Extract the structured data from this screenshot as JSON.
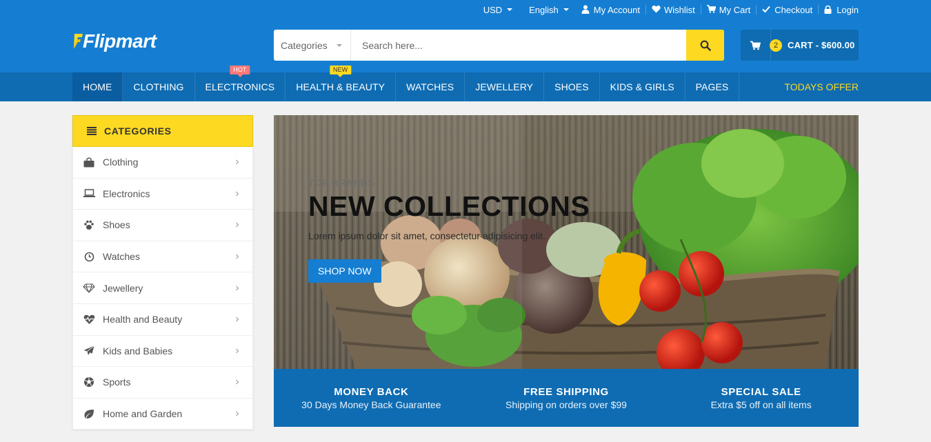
{
  "topbar": {
    "currency": "USD",
    "language": "English",
    "links": [
      {
        "label": "My Account",
        "icon": "user-icon"
      },
      {
        "label": "Wishlist",
        "icon": "heart-icon"
      },
      {
        "label": "My Cart",
        "icon": "cart-icon"
      },
      {
        "label": "Checkout",
        "icon": "check-icon"
      },
      {
        "label": "Login",
        "icon": "lock-icon"
      }
    ]
  },
  "brand": {
    "name": "Flipmart"
  },
  "search": {
    "category_label": "Categories",
    "placeholder": "Search here..."
  },
  "cart": {
    "count": "2",
    "label": "CART - $600.00"
  },
  "nav": {
    "items": [
      {
        "label": "HOME",
        "active": true
      },
      {
        "label": "CLOTHING"
      },
      {
        "label": "ELECTRONICS",
        "badge": "HOT"
      },
      {
        "label": "HEALTH & BEAUTY",
        "badge": "NEW"
      },
      {
        "label": "WATCHES"
      },
      {
        "label": "JEWELLERY"
      },
      {
        "label": "SHOES"
      },
      {
        "label": "KIDS & GIRLS"
      },
      {
        "label": "PAGES"
      }
    ],
    "offer": "TODAYS OFFER"
  },
  "sidebar": {
    "title": "CATEGORIES",
    "items": [
      {
        "label": "Clothing",
        "icon": "shopping-bag-icon"
      },
      {
        "label": "Electronics",
        "icon": "laptop-icon"
      },
      {
        "label": "Shoes",
        "icon": "paw-icon"
      },
      {
        "label": "Watches",
        "icon": "clock-icon"
      },
      {
        "label": "Jewellery",
        "icon": "diamond-icon"
      },
      {
        "label": "Health and Beauty",
        "icon": "heartbeat-icon"
      },
      {
        "label": "Kids and Babies",
        "icon": "paper-plane-icon"
      },
      {
        "label": "Sports",
        "icon": "soccer-ball-icon"
      },
      {
        "label": "Home and Garden",
        "icon": "leaf-icon"
      }
    ]
  },
  "hero": {
    "top": "TOP BRANDS",
    "title": "NEW COLLECTIONS",
    "description": "Lorem ipsum dolor sit amet, consectetur adipisicing elit.",
    "button": "SHOP NOW"
  },
  "info": [
    {
      "title": "MONEY BACK",
      "subtitle": "30 Days Money Back Guarantee"
    },
    {
      "title": "FREE SHIPPING",
      "subtitle": "Shipping on orders over $99"
    },
    {
      "title": "SPECIAL SALE",
      "subtitle": "Extra $5 off on all items"
    }
  ],
  "colors": {
    "primary": "#157ed2",
    "dark_blue": "#0f6cb2",
    "accent_yellow": "#fdd922",
    "hot_badge": "#ff7878"
  }
}
